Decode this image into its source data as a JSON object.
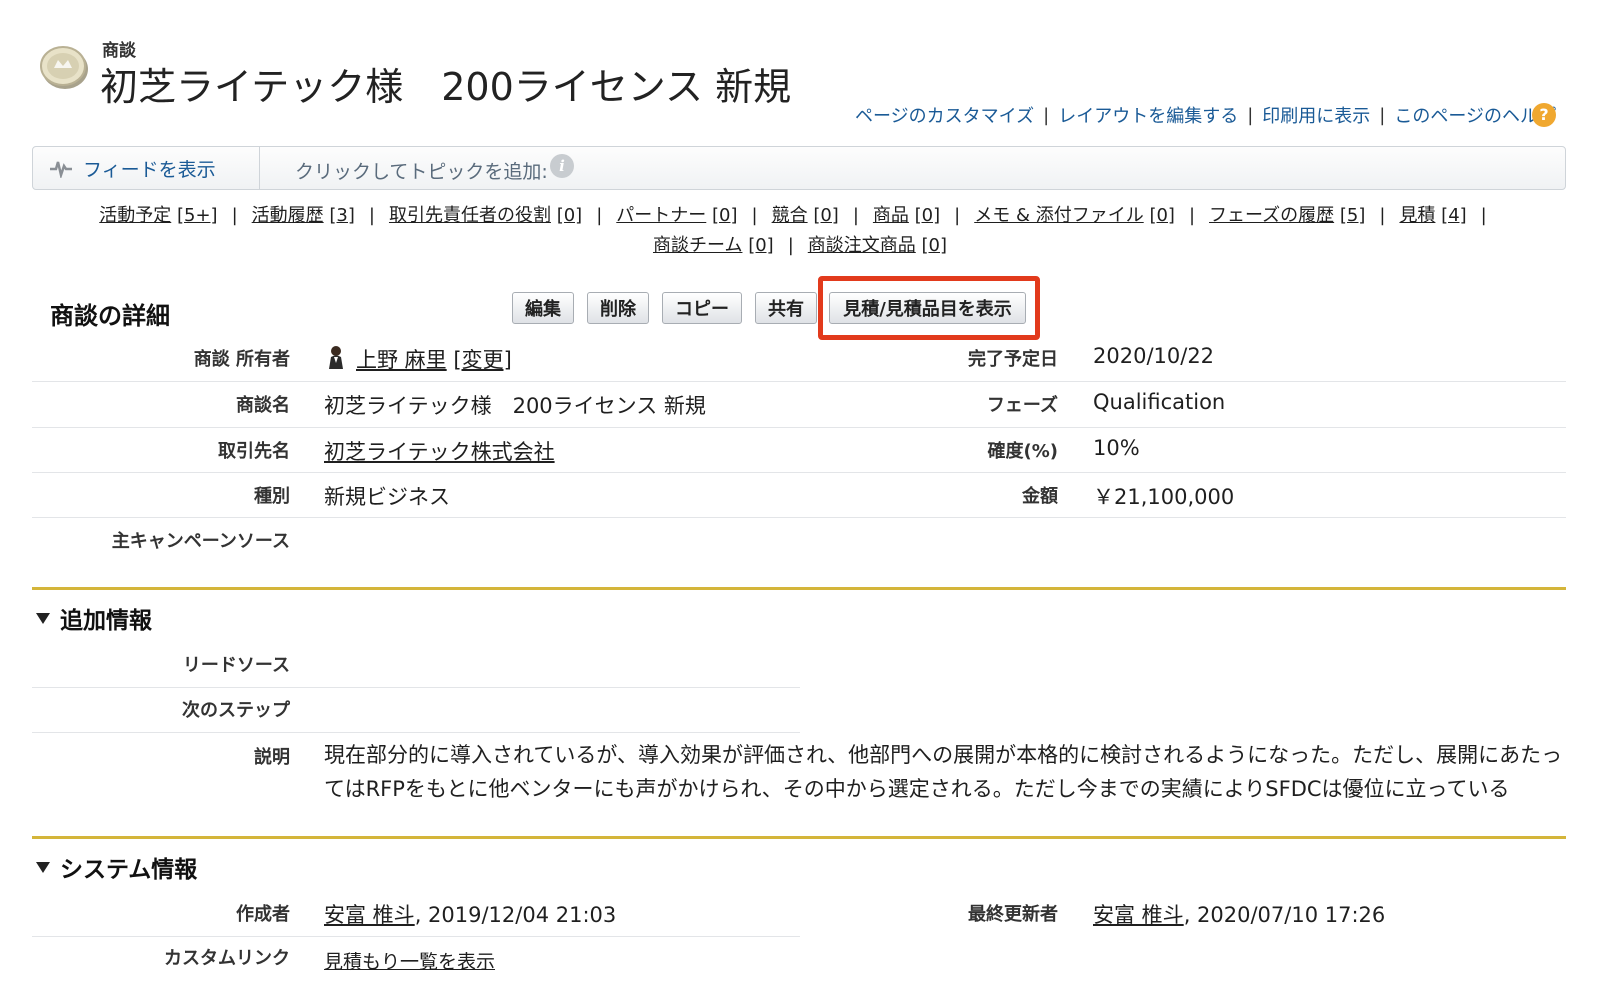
{
  "header": {
    "object_type": "商談",
    "title": "初芝ライテック様　200ライセンス 新規"
  },
  "top_links": {
    "customize": "ページのカスタマイズ",
    "edit_layout": "レイアウトを編集する",
    "printable": "印刷用に表示",
    "help": "このページのヘルプ",
    "sep": "|"
  },
  "feed": {
    "show_feed": "フィードを表示",
    "add_topic": "クリックしてトピックを追加:"
  },
  "related_links": [
    {
      "label": "活動予定",
      "count": "[5+]"
    },
    {
      "label": "活動履歴",
      "count": "[3]"
    },
    {
      "label": "取引先責任者の役割",
      "count": "[0]"
    },
    {
      "label": "パートナー",
      "count": "[0]"
    },
    {
      "label": "競合",
      "count": "[0]"
    },
    {
      "label": "商品",
      "count": "[0]"
    },
    {
      "label": "メモ & 添付ファイル",
      "count": "[0]"
    },
    {
      "label": "フェーズの履歴",
      "count": "[5]"
    },
    {
      "label": "見積",
      "count": "[4]"
    },
    {
      "label": "商談チーム",
      "count": "[0]"
    },
    {
      "label": "商談注文商品",
      "count": "[0]"
    }
  ],
  "detail": {
    "section_title": "商談の詳細",
    "buttons": {
      "edit": "編集",
      "delete": "削除",
      "copy": "コピー",
      "share": "共有",
      "view_quotes": "見積/見積品目を表示"
    },
    "fields": {
      "owner_label": "商談 所有者",
      "owner_value": "上野 麻里",
      "owner_change": "[変更]",
      "close_date_label": "完了予定日",
      "close_date_value": "2020/10/22",
      "name_label": "商談名",
      "name_value": "初芝ライテック様　200ライセンス 新規",
      "stage_label": "フェーズ",
      "stage_value": "Qualification",
      "account_label": "取引先名",
      "account_value": "初芝ライテック株式会社",
      "probability_label": "確度(%)",
      "probability_value": "10%",
      "type_label": "種別",
      "type_value": "新規ビジネス",
      "amount_label": "金額",
      "amount_value": "￥21,100,000",
      "campaign_label": "主キャンペーンソース"
    }
  },
  "additional": {
    "title": "追加情報",
    "lead_source_label": "リードソース",
    "next_step_label": "次のステップ",
    "description_label": "説明",
    "description_value": "現在部分的に導入されているが、導入効果が評価され、他部門への展開が本格的に検討されるようになった。ただし、展開にあたってはRFPをもとに他ベンターにも声がかけられ、その中から選定される。ただし今までの実績によりSFDCは優位に立っている"
  },
  "system": {
    "title": "システム情報",
    "created_label": "作成者",
    "created_user": "安富 椎斗",
    "created_date": ", 2019/12/04 21:03",
    "modified_label": "最終更新者",
    "modified_user": "安富 椎斗",
    "modified_date": ", 2020/07/10 17:26",
    "custom_links_label": "カスタムリンク",
    "custom_link_value": "見積もり一覧を表示"
  }
}
